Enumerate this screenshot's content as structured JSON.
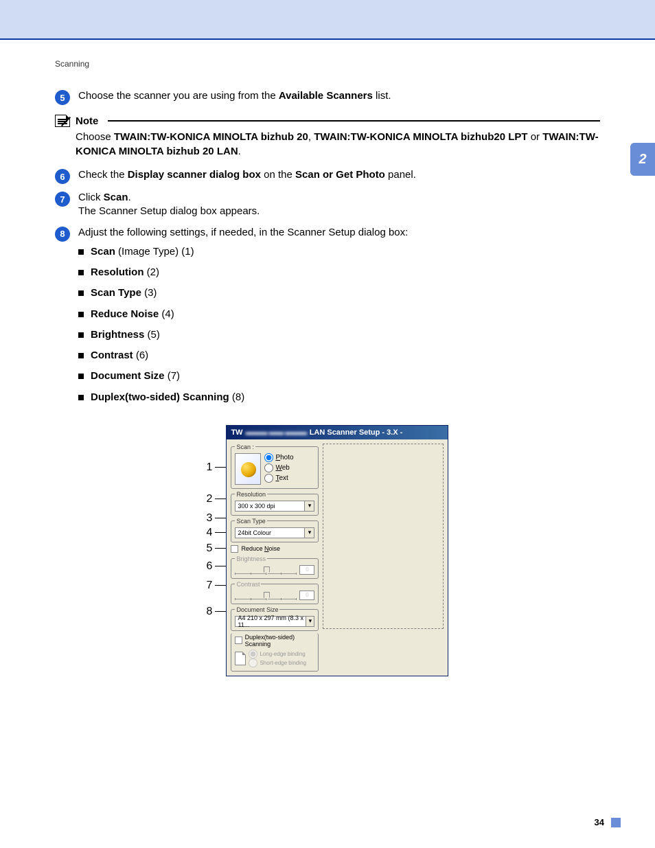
{
  "header": {
    "section": "Scanning"
  },
  "side_tab": "2",
  "steps": {
    "s5": {
      "num": "5",
      "pre": "Choose the scanner you are using from the ",
      "bold": "Available Scanners",
      "post": " list."
    },
    "s6": {
      "num": "6",
      "pre": "Check the ",
      "b1": "Display scanner dialog box",
      "mid": " on the ",
      "b2": "Scan or Get Photo",
      "post": " panel."
    },
    "s7": {
      "num": "7",
      "pre": "Click ",
      "b1": "Scan",
      "post": ".",
      "line2": "The Scanner Setup dialog box appears."
    },
    "s8": {
      "num": "8",
      "text": "Adjust the following settings, if needed, in the Scanner Setup dialog box:"
    }
  },
  "note": {
    "title": "Note",
    "pre": "Choose ",
    "b1": "TWAIN:TW-KONICA MINOLTA bizhub 20",
    "sep1": ", ",
    "b2": "TWAIN:TW-KONICA MINOLTA bizhub20 LPT",
    "sep2": " or ",
    "b3": "TWAIN:TW-KONICA MINOLTA bizhub 20 LAN",
    "post": "."
  },
  "bullets": [
    {
      "b": "Scan",
      "t": " (Image Type) (1)"
    },
    {
      "b": "Resolution",
      "t": " (2)"
    },
    {
      "b": "Scan Type",
      "t": " (3)"
    },
    {
      "b": "Reduce Noise",
      "t": " (4)"
    },
    {
      "b": "Brightness",
      "t": " (5)"
    },
    {
      "b": "Contrast",
      "t": " (6)"
    },
    {
      "b": "Document Size",
      "t": " (7)"
    },
    {
      "b": "Duplex(two-sided) Scanning",
      "t": " (8)"
    }
  ],
  "callout_labels": [
    "1",
    "2",
    "3",
    "4",
    "5",
    "6",
    "7",
    "8"
  ],
  "dialog": {
    "title_prefix": "TW",
    "title_blur": "▬▬▬ ▬▬ ▬▬▬",
    "title_suffix": "LAN Scanner Setup - 3.X -",
    "scan": {
      "legend": "Scan :",
      "opt_photo": "Photo",
      "opt_web": "Web",
      "opt_text": "Text"
    },
    "resolution": {
      "legend": "Resolution",
      "value": "300 x 300 dpi"
    },
    "scantype": {
      "legend": "Scan Type",
      "value": "24bit Colour"
    },
    "reduce_noise": "Reduce Noise",
    "brightness": {
      "legend": "Brightness",
      "val": "0"
    },
    "contrast": {
      "legend": "Contrast",
      "val": "0"
    },
    "docsize": {
      "legend": "Document Size",
      "value": "A4 210 x 297 mm (8.3 x 11..."
    },
    "duplex": {
      "check": "Duplex(two-sided) Scanning",
      "r1": "Long-edge binding",
      "r2": "Short-edge binding"
    }
  },
  "page_number": "34"
}
